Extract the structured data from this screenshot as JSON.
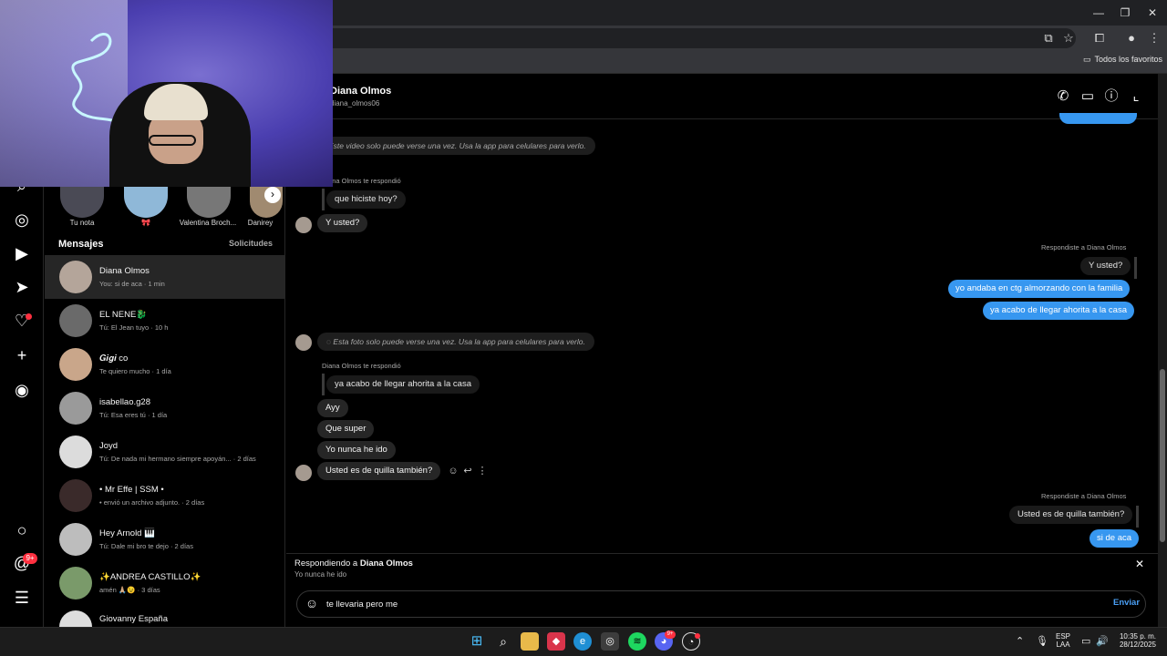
{
  "browser": {
    "bookmarks_folder": "Todos los favoritos"
  },
  "stories": [
    {
      "label": "Tu nota"
    },
    {
      "label": "🎀"
    },
    {
      "label": "Valentina Broch..."
    },
    {
      "label": "Danirey"
    }
  ],
  "list": {
    "header": "Mensajes",
    "requests": "Solicitudes",
    "conversations": [
      {
        "name": "Diana Olmos",
        "preview": "You: si de aca · 1 min"
      },
      {
        "name": "EL NENE🐉",
        "preview": "Tú: El Jean tuyo · 10 h"
      },
      {
        "name": "𝑮𝒊𝒈𝒊 co",
        "preview": "Te quiero mucho · 1 día"
      },
      {
        "name": "isabellao.g28",
        "preview": "Tú: Esa eres tú · 1 día"
      },
      {
        "name": "Joyd",
        "preview": "Tú: De nada mi hermano siempre apoyán... · 2 días"
      },
      {
        "name": "• Mr Effe | SSM •",
        "preview": "• envió un archivo adjunto. · 2 días"
      },
      {
        "name": "Hey Arnold 🎹",
        "preview": "Tú: Dale mi bro te dejo · 2 días"
      },
      {
        "name": "✨ANDREA CASTILLO✨",
        "preview": "amén 🙏🏼😉 · 3 días"
      },
      {
        "name": "Giovanny España",
        "preview": ""
      }
    ]
  },
  "chat": {
    "name": "Diana Olmos",
    "username": "diana_olmos06",
    "messages": {
      "sys_video": "Este video solo puede verse una vez. Usa la app para celulares para verlo.",
      "reply_note_1": "Diana Olmos te respondió",
      "quote_1": "que hiciste hoy?",
      "in_1": "Y usted?",
      "out_note_1": "Respondiste a Diana Olmos",
      "out_quote_1": "Y usted?",
      "out_1": "yo andaba en ctg almorzando con la familia",
      "out_2": "ya acabo de llegar ahorita a la casa",
      "sys_photo": "Esta foto solo puede verse una vez. Usa la app para celulares para verlo.",
      "reply_note_2": "Diana Olmos te respondió",
      "quote_2": "ya acabo de llegar ahorita a la casa",
      "in_2": "Ayy",
      "in_3": "Que super",
      "in_4": "Yo nunca he ido",
      "in_5": "Usted es de quilla también?",
      "out_note_2": "Respondiste a Diana Olmos",
      "out_quote_2": "Usted es de quilla también?",
      "out_3": "si de aca"
    },
    "replying_prefix": "Respondiendo a ",
    "replying_name": "Diana Olmos",
    "replying_text": "Yo nunca he ido",
    "input_value": "te llevaria pero me ",
    "send_label": "Enviar"
  },
  "taskbar": {
    "lang_1": "ESP",
    "lang_2": "LAA",
    "time": "10:35 p. m.",
    "date": "28/12/2025",
    "discord_badge": "9+"
  },
  "nav": {
    "notif_badge": "9+"
  },
  "colors": {
    "outgoing_bubble": "#3797f0",
    "incoming_bubble": "#262626",
    "accent_link": "#4a9ff5",
    "notification": "#ff3040"
  }
}
